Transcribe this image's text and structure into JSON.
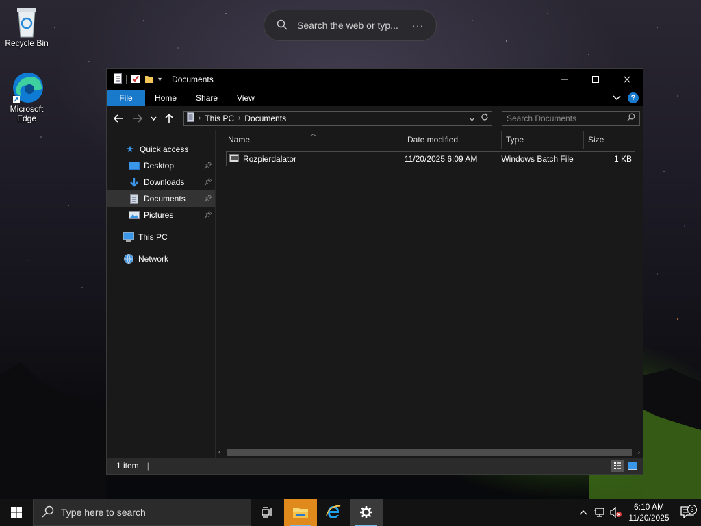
{
  "desktop": {
    "icons": [
      {
        "label": "Recycle Bin"
      },
      {
        "label": "Microsoft\nEdge",
        "line1": "Microsoft",
        "line2": "Edge"
      }
    ],
    "web_search_placeholder": "Search the web or typ...",
    "web_search_more": "···"
  },
  "window": {
    "title": "Documents",
    "ribbon_tabs": [
      "File",
      "Home",
      "Share",
      "View"
    ],
    "address": {
      "root": "This PC",
      "current": "Documents"
    },
    "search_placeholder": "Search Documents",
    "nav": {
      "quick_access": "Quick access",
      "items": [
        "Desktop",
        "Downloads",
        "Documents",
        "Pictures"
      ],
      "selected": "Documents",
      "this_pc": "This PC",
      "network": "Network"
    },
    "columns": [
      "Name",
      "Date modified",
      "Type",
      "Size"
    ],
    "files": [
      {
        "name": "Rozpierdalator",
        "date": "11/20/2025 6:09 AM",
        "type": "Windows Batch File",
        "size": "1 KB"
      }
    ],
    "status": "1 item"
  },
  "taskbar": {
    "search_placeholder": "Type here to search",
    "time": "6:10 AM",
    "date": "11/20/2025",
    "notification_count": "3",
    "accent": "#1979ca"
  }
}
